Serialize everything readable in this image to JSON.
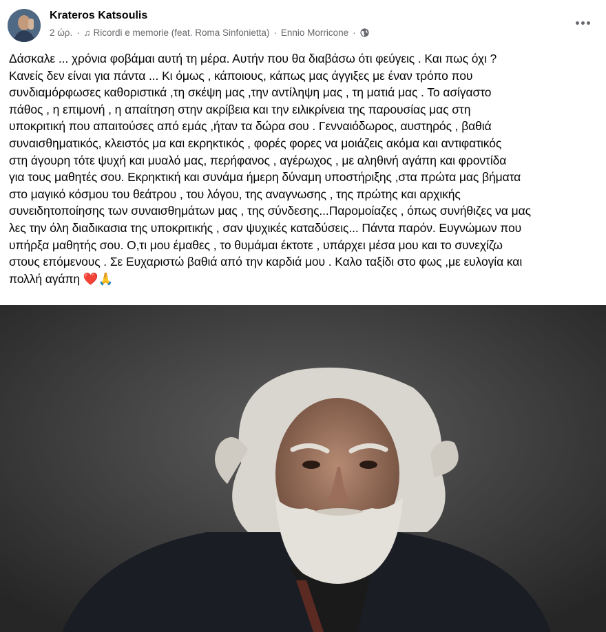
{
  "post": {
    "author": "Krateros Katsoulis",
    "time": "2 ώρ.",
    "separator": "·",
    "music_icon": "music-note-icon",
    "song": "Ricordi e memorie (feat. Roma Sinfonietta)",
    "artist": "Ennio Morricone",
    "audience_icon": "globe-icon",
    "more_icon": "more-options-icon",
    "body": "Δάσκαλε ... χρόνια φοβάμαι αυτή τη  μέρα. Αυτήν που θα διαβάσω ότι φεύγεις . Και πως όχι ?\nΚανείς δεν είναι για πάντα ... Κι όμως , κάποιους,  κάπως μας  άγγιξες  με έναν τρόπο που\nσυνδιαμόρφωσες  καθοριστικά ,τη σκέψη μας ,την αντίληψη μας , τη ματιά μας . Το ασίγαστο\nπάθος , η επιμονή , η απαίτηση στην ακρίβεια και την ειλικρίνεια της παρουσίας μας στη\nυποκριτική που απαιτούσες από εμάς ,ήταν τα δώρα σου . Γενναιόδωρος, αυστηρός , βαθιά\nσυναισθηματικός, κλειστός μα και εκρηκτικός , φορές φορες να μοιάζεις  ακόμα  και αντιφατικός\nστη  άγουρη τότε ψυχή και μυαλό μας,  περήφανος , αγέρωχος , με αληθινή αγάπη και φροντίδα\nγια τους μαθητές σου. Εκρηκτική και συνάμα ήμερη δύναμη υποστήριξης ,στα πρώτα μας βήματα\nστο μαγικό κόσμου του θεάτρου , του λόγου, της αναγνωσης , της πρώτης και αρχικής\nσυνειδητοποίησης  των συναισθημάτων μας , της σύνδεσης...Παρομοίαζες , όπως συνήθιζες να μας\nλες την όλη διαδικασια  της υποκριτικής  , σαν ψυχικές καταδύσεις... Πάντα παρόν. Ευγνώμων που\nυπήρξα μαθητής σου. Ο,τι μου έμαθες , το θυμάμαι έκτοτε , υπάρχει μέσα μου και το συνεχίζω\nστους  επόμενους . Σε Ευχαριστώ βαθιά από την καρδιά μου . Καλο ταξίδι στο φως ,με ευλογία και\nπολλή αγάπη",
    "emoji": "❤️🙏",
    "photo_icon": "portrait-photo"
  }
}
